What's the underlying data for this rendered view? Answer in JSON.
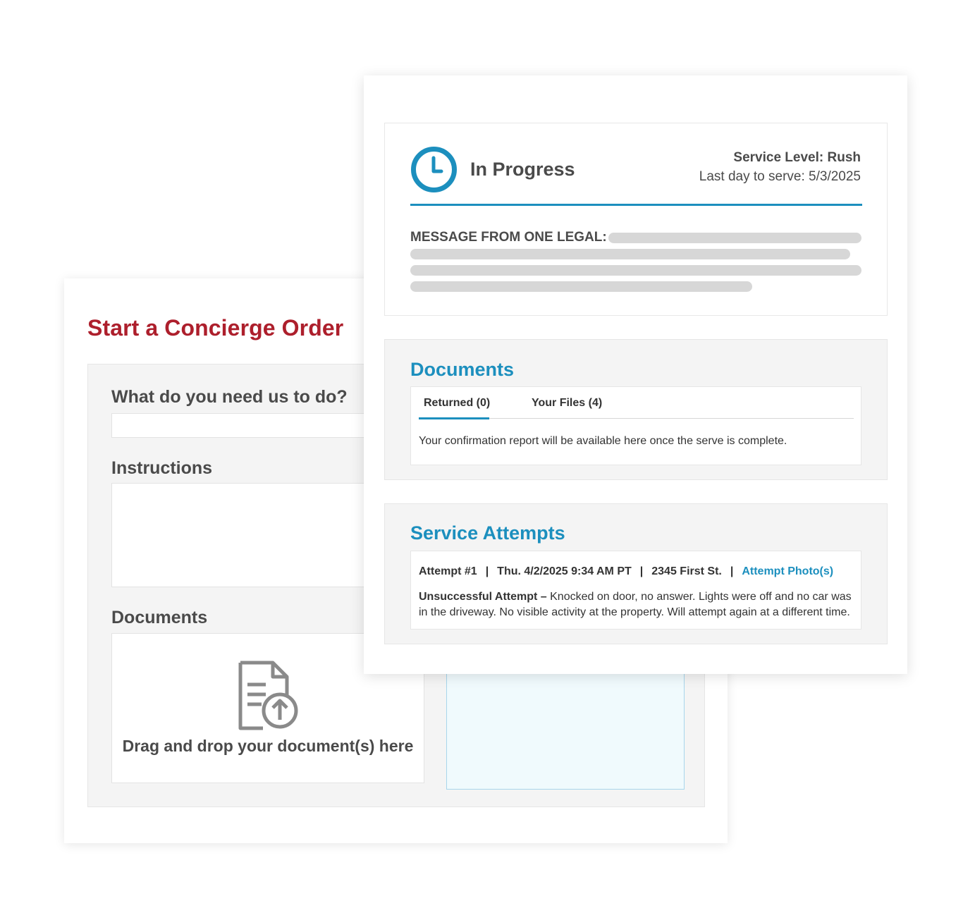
{
  "concierge": {
    "title": "Start a Concierge Order",
    "need_label": "What do you need us to do?",
    "instructions_label": "Instructions",
    "documents_label": "Documents",
    "drop_text": "Drag and drop your document(s) here",
    "drop_icon": "document-upload-icon"
  },
  "status": {
    "icon": "clock-icon",
    "text": "In Progress",
    "service_level": "Service Level: Rush",
    "last_day": "Last day to serve: 5/3/2025",
    "message_label": "MESSAGE FROM ONE LEGAL:"
  },
  "documents": {
    "title": "Documents",
    "tabs": [
      {
        "label": "Returned (0)",
        "active": true
      },
      {
        "label": "Your Files (4)",
        "active": false
      }
    ],
    "note": "Your confirmation report will be available here once the serve is complete."
  },
  "attempts": {
    "title": "Service Attempts",
    "items": [
      {
        "number": "Attempt #1",
        "date": "Thu. 4/2/2025 9:34 AM PT",
        "address": "2345 First St.",
        "photos_link": "Attempt Photo(s)",
        "result": "Unsuccessful Attempt –",
        "detail": "Knocked on door, no answer. Lights were off and no car was in the driveway. No visible activity at the property. Will attempt again at a different time."
      }
    ]
  },
  "colors": {
    "brand_red": "#ad1f2c",
    "accent_blue": "#1c8fbe",
    "panel_gray": "#f4f4f4",
    "text_dark": "#4a4a4a"
  }
}
